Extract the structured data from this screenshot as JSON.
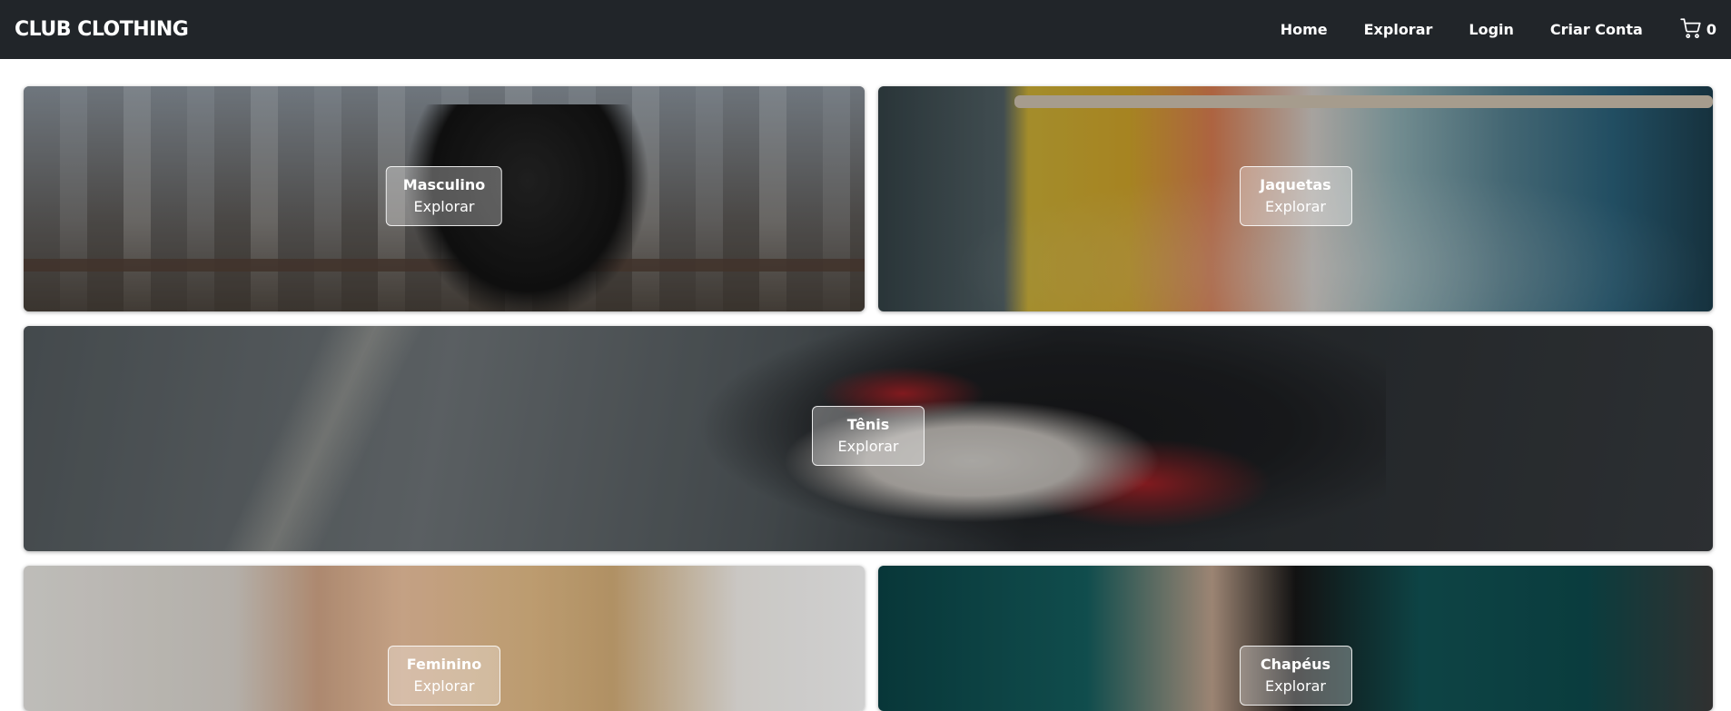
{
  "navbar": {
    "brand": "CLUB CLOTHING",
    "links": [
      "Home",
      "Explorar",
      "Login",
      "Criar Conta"
    ],
    "cart_icon": "cart-icon",
    "cart_count": "0"
  },
  "categories": [
    {
      "title": "Masculino",
      "action": "Explorar"
    },
    {
      "title": "Jaquetas",
      "action": "Explorar"
    },
    {
      "title": "Tênis",
      "action": "Explorar"
    },
    {
      "title": "Feminino",
      "action": "Explorar"
    },
    {
      "title": "Chapéus",
      "action": "Explorar"
    }
  ]
}
